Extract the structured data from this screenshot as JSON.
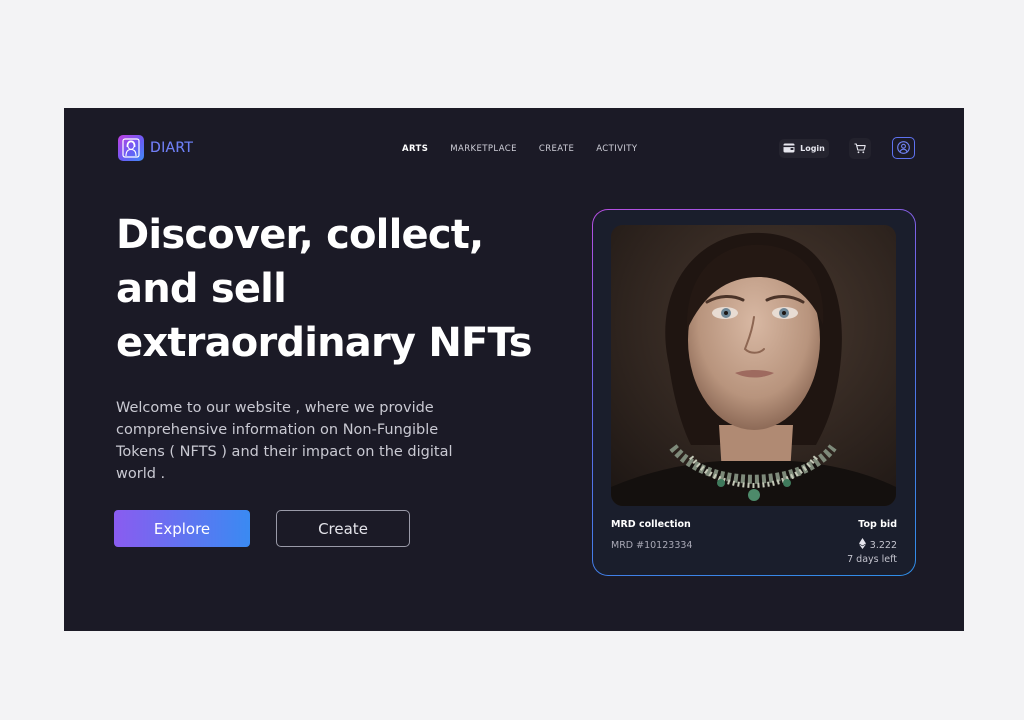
{
  "header": {
    "logo_text": "DIART",
    "nav": [
      {
        "label": "ARTS",
        "active": true
      },
      {
        "label": "MARKETPLACE",
        "active": false
      },
      {
        "label": "CREATE",
        "active": false
      },
      {
        "label": "ACTIVITY",
        "active": false
      }
    ],
    "login_label": "Login",
    "icons": {
      "logo": "mona-lisa-logo-icon",
      "login": "wallet-icon",
      "cart": "cart-icon",
      "user": "user-circle-icon"
    }
  },
  "hero": {
    "title": "Discover, collect, and sell extraordinary NFTs",
    "description": "Welcome to our website , where we provide comprehensive information on Non-Fungible Tokens ( NFTS ) and their impact on the digital world .",
    "explore_label": "Explore",
    "create_label": "Create"
  },
  "card": {
    "collection": "MRD collection",
    "item_id": "MRD #10123334",
    "top_bid_label": "Top bid",
    "price": "3.222",
    "price_icon": "ethereum-icon",
    "time_left": "7 days left",
    "image_icon": "portrait-image"
  },
  "colors": {
    "background": "#1b1a26",
    "page": "#f3f3f5",
    "accent_start": "#8a5cf0",
    "accent_end": "#3a8af2",
    "card_border_top": "#b64ee0",
    "card_border_bottom": "#2f8ee8"
  }
}
